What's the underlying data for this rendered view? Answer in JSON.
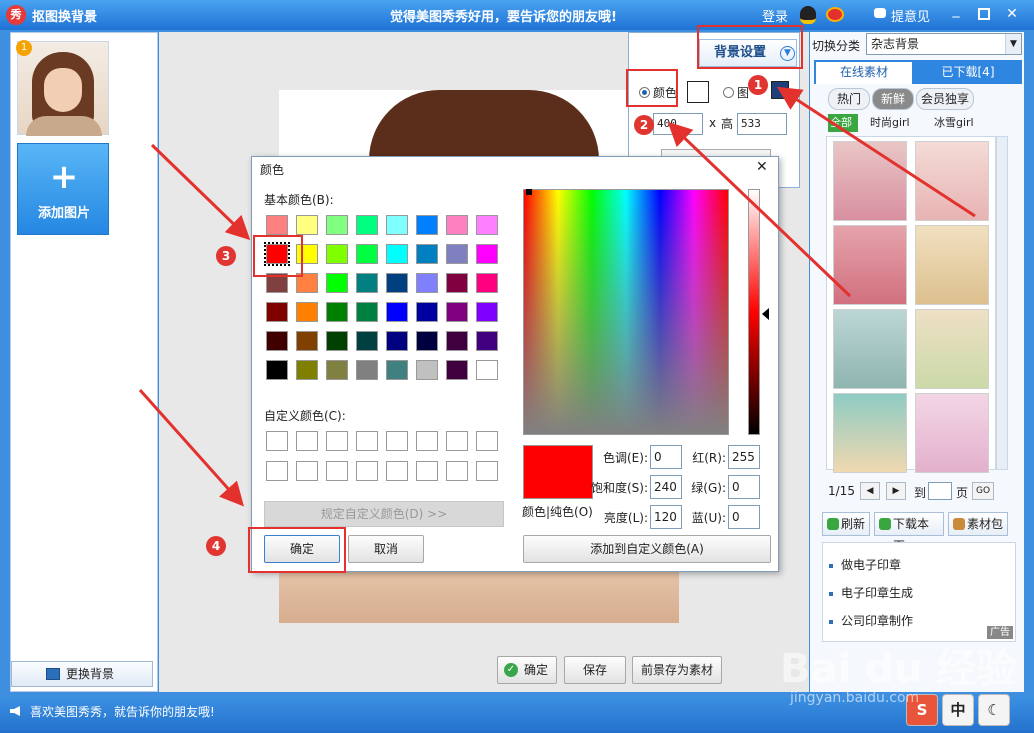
{
  "app": {
    "title": "抠图换背景",
    "slogan": "觉得美图秀秀好用，要告诉您的朋友哦!",
    "login_label": "登录",
    "feedback_label": "提意见",
    "logo_text": "秀"
  },
  "left_panel": {
    "thumbnail_badge": "1",
    "add_image_icon": "+",
    "add_image_label": "添加图片",
    "change_bg_label": "更换背景"
  },
  "canvas": {
    "confirm_label": "确定",
    "save_label": "保存",
    "save_foreground_label": "前景存为素材"
  },
  "bg_settings": {
    "title": "背景设置",
    "color_option": "颜色",
    "image_option": "图",
    "width_value": "400",
    "height_label": "高",
    "height_value": "533",
    "times": "x"
  },
  "right_panel": {
    "category_label": "切换分类",
    "category_value": "杂志背景",
    "tabs": [
      "在线素材",
      "已下载[4]"
    ],
    "subtabs": [
      "热门",
      "新鲜",
      "会员独享"
    ],
    "filters": [
      "全部",
      "时尚girl",
      "冰雪girl"
    ],
    "page_current": "1/15",
    "goto_label": "到",
    "page_unit": "页",
    "go_label": "GO",
    "refresh_label": "刷新",
    "download_page_label": "下载本页",
    "package_label": "素材包",
    "ads": [
      "做电子印章",
      "电子印章生成",
      "公司印章制作"
    ],
    "ad_tag": "广告"
  },
  "color_dialog": {
    "title": "颜色",
    "basic_colors_label": "基本颜色(B):",
    "basic_colors": [
      "#ff8080",
      "#ffff80",
      "#80ff80",
      "#00ff80",
      "#80ffff",
      "#0080ff",
      "#ff80c0",
      "#ff80ff",
      "#ff0000",
      "#ffff00",
      "#80ff00",
      "#00ff40",
      "#00ffff",
      "#0080c0",
      "#8080c0",
      "#ff00ff",
      "#804040",
      "#ff8040",
      "#00ff00",
      "#008080",
      "#004080",
      "#8080ff",
      "#800040",
      "#ff0080",
      "#800000",
      "#ff8000",
      "#008000",
      "#008040",
      "#0000ff",
      "#0000a0",
      "#800080",
      "#8000ff",
      "#400000",
      "#804000",
      "#004000",
      "#004040",
      "#000080",
      "#000040",
      "#400040",
      "#400080",
      "#000000",
      "#808000",
      "#808040",
      "#808080",
      "#408080",
      "#c0c0c0",
      "#400040",
      "#ffffff"
    ],
    "custom_colors_label": "自定义颜色(C):",
    "define_custom_label": "规定自定义颜色(D) >>",
    "preview_label": "颜色|纯色(O)",
    "hue_label": "色调(E):",
    "hue_value": "0",
    "sat_label": "饱和度(S):",
    "sat_value": "240",
    "lum_label": "亮度(L):",
    "lum_value": "120",
    "red_label": "红(R):",
    "red_value": "255",
    "green_label": "绿(G):",
    "green_value": "0",
    "blue_label": "蓝(U):",
    "blue_value": "0",
    "add_custom_label": "添加到自定义颜色(A)",
    "ok_label": "确定",
    "cancel_label": "取消"
  },
  "callouts": [
    "1",
    "2",
    "3",
    "4"
  ],
  "status": {
    "text": "喜欢美图秀秀，就告诉你的朋友哦!",
    "tray": [
      "中"
    ]
  },
  "watermark": {
    "main": "Bai du 经验",
    "sub": "jingyan.baidu.com"
  },
  "colors": {
    "accent": "#2f86e0",
    "callout": "#e3322e"
  }
}
